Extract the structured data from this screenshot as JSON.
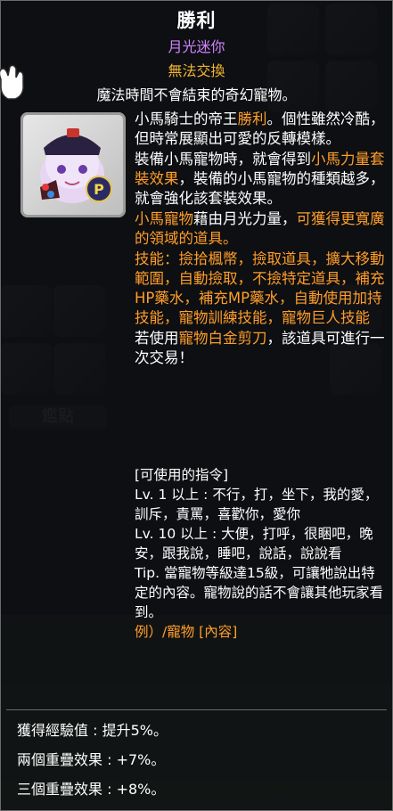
{
  "item": {
    "name": "勝利",
    "subtitle": "月光迷你",
    "trade_status": "無法交換",
    "tagline": "魔法時間不會結束的奇幻寵物。"
  },
  "description": {
    "p1a": "小馬騎士的帝王",
    "p1b": "勝利",
    "p1c": "。個性雖然冷酷，但時常展顯出可愛的反轉模樣。",
    "p2a": "裝備小馬寵物時，就會得到",
    "p2b": "小馬力量套裝效果",
    "p2c": "，裝備的小馬寵物的種類越多，就會強化該套裝效果。",
    "p3a": "小馬寵物",
    "p3b": "藉由月光力量，",
    "p3c": "可獲得更寬廣的領域的道具。",
    "p4": "技能：撿拾楓幣，撿取道具，擴大移動範圍，自動撿取，不撿特定道具，補充HP藥水，補充MP藥水，自動使用加持技能，寵物訓練技能，寵物巨人技能",
    "p5a": "若使用",
    "p5b": "寵物白金剪刀",
    "p5c": "，該道具可進行一次交易！"
  },
  "commands": {
    "header": "[可使用的指令]",
    "lv1": "Lv. 1 以上 : 不行，打，坐下，我的愛，訓斥，責罵，喜歡你，愛你",
    "lv10": "Lv. 10 以上 : 大便，打呼，很睏吧，晚安，跟我說，睡吧，說話，說說看",
    "tip": "Tip. 當寵物等級達15級，可讓牠說出特定的內容。寵物說的話不會讓其他玩家看到。",
    "example": "例）/寵物 [內容]"
  },
  "stats": [
    {
      "label": "獲得經驗值 : 提升5%。"
    },
    {
      "label": "兩個重疊效果 : +7%。"
    },
    {
      "label": "三個重疊效果 : +8%。"
    }
  ],
  "background": {
    "tab_label": "鑑點"
  },
  "colors": {
    "title": "#ffffff",
    "subtitle": "#d283ff",
    "untradeable": "#f2b630",
    "highlight": "#ff9d2a"
  }
}
